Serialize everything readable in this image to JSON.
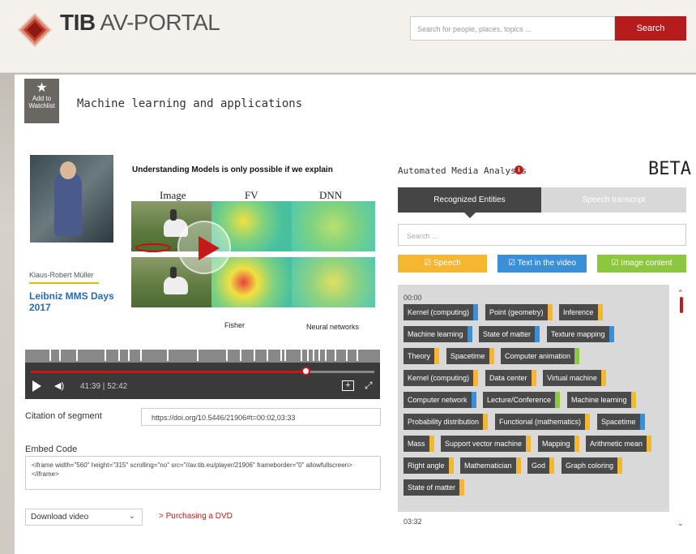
{
  "header": {
    "logo_bold": "TIB",
    "logo_rest": "AV-PORTAL",
    "search_placeholder": "Search for people, places, topics ...",
    "search_button": "Search"
  },
  "watchlist": {
    "icon": "star-icon",
    "label": "Add to Watchlist"
  },
  "page_title": "Machine learning and applications",
  "video": {
    "speaker": "Klaus-Robert Müller",
    "event": "Leibniz MMS Days 2017",
    "slide_title": "Understanding Models is only possible if we explain",
    "columns": [
      "Image",
      "FV",
      "DNN"
    ],
    "slide_captions": [
      "Fisher",
      "Neural networks"
    ],
    "time_current": "41:39",
    "time_total": "52:42",
    "progress": 0.8
  },
  "citation": {
    "label": "Citation of segment",
    "value": "https://doi.org/10.5446/21906#t=00:02,03:33"
  },
  "embed": {
    "label": "Embed Code",
    "value": "<iframe width=\"560\" height=\"315\" scrolling=\"no\" src=\"//av.tib.eu/player/21906\" frameborder=\"0\" allowfullscreen></iframe>"
  },
  "download": {
    "selected": "Download video",
    "dvd_link": "> Purchasing a DVD"
  },
  "analysis": {
    "title": "Automated Media Analysis",
    "beta": "BETA",
    "tabs": [
      "Recognized Entities",
      "Speech transcript"
    ],
    "search_placeholder": "Search ...",
    "filters": [
      {
        "label": "☑ Speech",
        "color": "#f5b731"
      },
      {
        "label": "☑ Text in the video",
        "color": "#3a8fd6"
      },
      {
        "label": "☑ Image content",
        "color": "#8dc63f"
      }
    ],
    "time_start": "00:00",
    "time_end": "03:32",
    "colors": {
      "speech": "#f5b731",
      "text": "#3a8fd6",
      "image": "#8dc63f"
    },
    "entity_rows": [
      [
        {
          "label": "Kernel (computing)",
          "src": "text"
        },
        {
          "label": "Point (geometry)",
          "src": "speech"
        },
        {
          "label": "Inference",
          "src": "speech"
        }
      ],
      [
        {
          "label": "Machine learning",
          "src": "text"
        },
        {
          "label": "State of matter",
          "src": "text"
        },
        {
          "label": "Texture mapping",
          "src": "text"
        }
      ],
      [
        {
          "label": "Theory",
          "src": "speech"
        },
        {
          "label": "Spacetime",
          "src": "speech"
        },
        {
          "label": "Computer animation",
          "src": "image"
        }
      ],
      [
        {
          "label": "Kernel (computing)",
          "src": "speech"
        },
        {
          "label": "Data center",
          "src": "speech"
        },
        {
          "label": "Virtual machine",
          "src": "speech"
        }
      ],
      [
        {
          "label": "Computer network",
          "src": "text"
        },
        {
          "label": "Lecture/Conference",
          "src": "image"
        },
        {
          "label": "Machine learning",
          "src": "speech"
        }
      ],
      [
        {
          "label": "Probability distribution",
          "src": "speech"
        },
        {
          "label": "Functional (mathematics)",
          "src": "speech"
        },
        {
          "label": "Spacetime",
          "src": "text"
        }
      ],
      [
        {
          "label": "Mass",
          "src": "speech"
        },
        {
          "label": "Support vector machine",
          "src": "speech"
        },
        {
          "label": "Mapping",
          "src": "speech"
        },
        {
          "label": "Arithmetic mean",
          "src": "speech"
        }
      ],
      [
        {
          "label": "Right angle",
          "src": "speech"
        },
        {
          "label": "Mathematician",
          "src": "speech"
        },
        {
          "label": "God",
          "src": "speech"
        },
        {
          "label": "Graph coloring",
          "src": "speech"
        }
      ],
      [
        {
          "label": "State of matter",
          "src": "speech"
        }
      ]
    ]
  }
}
